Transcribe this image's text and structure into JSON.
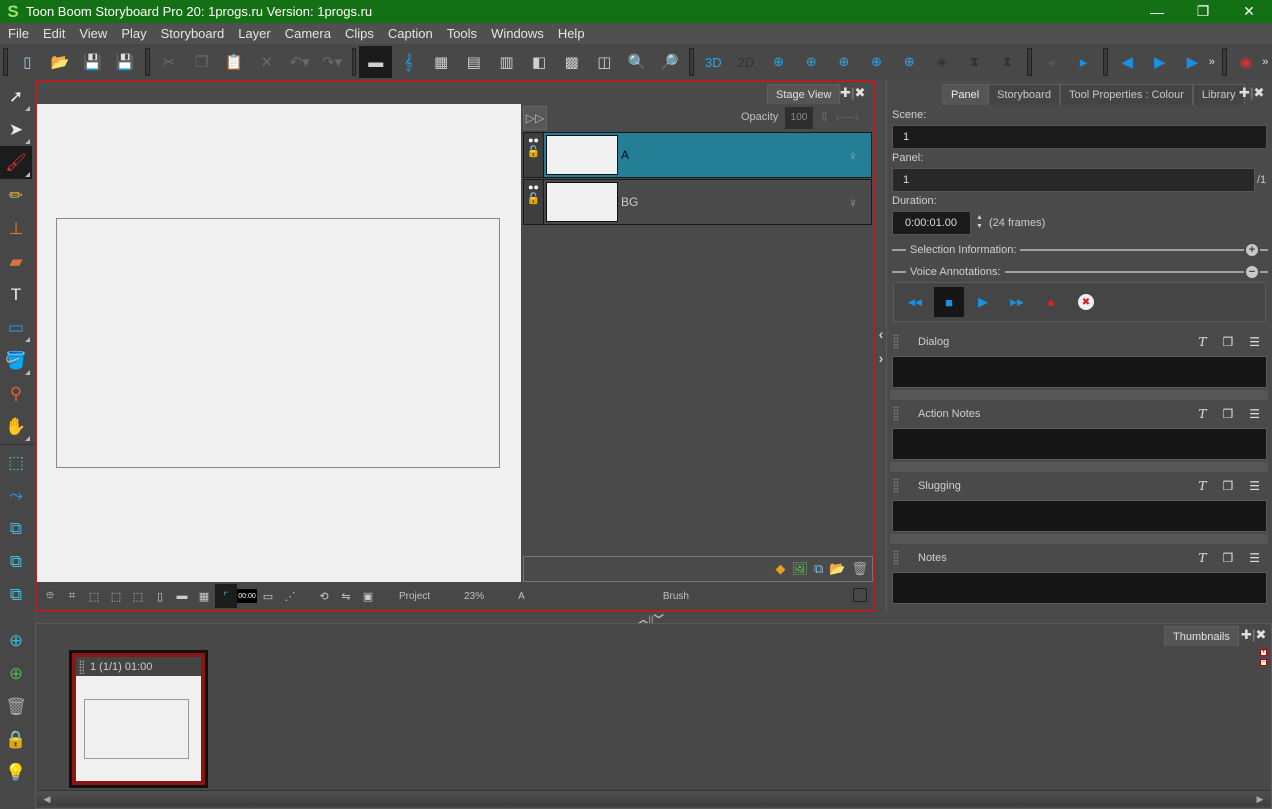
{
  "window": {
    "title": "Toon Boom Storyboard Pro 20: 1progs.ru Version: 1progs.ru",
    "logo": "S",
    "buttons": {
      "minimize": "—",
      "maximize": "❐",
      "close": "✕"
    }
  },
  "menu": [
    "File",
    "Edit",
    "View",
    "Play",
    "Storyboard",
    "Layer",
    "Camera",
    "Clips",
    "Caption",
    "Tools",
    "Windows",
    "Help"
  ],
  "toolbar": {
    "file_group": [
      {
        "name": "new-project-icon",
        "glyph": "▯"
      },
      {
        "name": "open-project-icon",
        "glyph": "📂"
      },
      {
        "name": "save-icon",
        "glyph": "💾"
      },
      {
        "name": "save-as-icon",
        "glyph": "💾"
      }
    ],
    "edit_group": [
      {
        "name": "cut-icon",
        "glyph": "✂"
      },
      {
        "name": "copy-icon",
        "glyph": "❐"
      },
      {
        "name": "paste-icon",
        "glyph": "📋"
      },
      {
        "name": "delete-icon",
        "glyph": "✕"
      },
      {
        "name": "undo-icon",
        "glyph": "↶▾"
      },
      {
        "name": "redo-icon",
        "glyph": "↷▾"
      }
    ],
    "view_group": [
      {
        "name": "horizontal-workspace-icon",
        "glyph": "▬"
      },
      {
        "name": "audio-clef-icon",
        "glyph": "𝄞"
      },
      {
        "name": "grid-layout-icon",
        "glyph": "▦"
      },
      {
        "name": "two-column-layout-icon",
        "glyph": "▤"
      },
      {
        "name": "list-layout-icon",
        "glyph": "▥"
      },
      {
        "name": "single-panel-layout-icon",
        "glyph": "◧"
      },
      {
        "name": "thumbnail-layout-icon",
        "glyph": "▩"
      },
      {
        "name": "timeline-layout-icon",
        "glyph": "◫"
      },
      {
        "name": "zoom-out-icon",
        "glyph": "🔍"
      },
      {
        "name": "zoom-in-icon",
        "glyph": "🔎"
      }
    ],
    "layer_group": [
      {
        "name": "convert-3d-icon",
        "glyph": "3D"
      },
      {
        "name": "convert-2d-icon",
        "glyph": "2D"
      },
      {
        "name": "add-panel-before-icon",
        "glyph": "⊕"
      },
      {
        "name": "add-panel-icon",
        "glyph": "⊕"
      },
      {
        "name": "add-panel-after-icon",
        "glyph": "⊕"
      },
      {
        "name": "split-panel-icon",
        "glyph": "⊕"
      },
      {
        "name": "smart-add-panel-icon",
        "glyph": "⊕"
      },
      {
        "name": "join-panel-icon",
        "glyph": "◈"
      },
      {
        "name": "add-transition-icon",
        "glyph": "⧗"
      },
      {
        "name": "remove-transition-icon",
        "glyph": "⧗"
      }
    ],
    "playback_group": [
      {
        "name": "previous-panel-icon",
        "glyph": "◂"
      },
      {
        "name": "next-panel-icon",
        "glyph": "▸"
      }
    ],
    "play_group": [
      {
        "name": "first-frame-icon",
        "glyph": "◀"
      },
      {
        "name": "play-selection-icon",
        "glyph": "▶"
      },
      {
        "name": "play-icon",
        "glyph": "▶"
      }
    ],
    "more": "»",
    "extra": {
      "name": "sound-scrub-icon",
      "glyph": "◉"
    }
  },
  "tools": [
    {
      "name": "select-tool-icon",
      "glyph": "➚",
      "has_menu": true,
      "color": "#e8e8e8"
    },
    {
      "name": "transform-tool-icon",
      "glyph": "➤",
      "has_menu": true,
      "color": "#e8e8e8"
    },
    {
      "name": "brush-tool-icon",
      "glyph": "🖌",
      "has_menu": true,
      "active": true,
      "color": "#d33"
    },
    {
      "name": "pencil-tool-icon",
      "glyph": "✏",
      "has_menu": false,
      "color": "#f0b040"
    },
    {
      "name": "stamp-tool-icon",
      "glyph": "⊥",
      "has_menu": false,
      "color": "#e08020"
    },
    {
      "name": "eraser-tool-icon",
      "glyph": "▰",
      "has_menu": false,
      "color": "#e07040"
    },
    {
      "name": "text-tool-icon",
      "glyph": "T",
      "has_menu": false,
      "color": "#eeeeee"
    },
    {
      "name": "rectangle-tool-icon",
      "glyph": "▭",
      "has_menu": true,
      "color": "#3399ee"
    },
    {
      "name": "paint-bucket-tool-icon",
      "glyph": "🪣",
      "has_menu": true,
      "color": "#d22"
    },
    {
      "name": "dropper-tool-icon",
      "glyph": "⚲",
      "has_menu": false,
      "color": "#e06030"
    },
    {
      "name": "hand-tool-icon",
      "glyph": "✋",
      "has_menu": true,
      "color": "#eeeeee"
    },
    {
      "name": "camera-box-icon",
      "glyph": "⬚",
      "has_menu": false,
      "color": "#40c0e0"
    },
    {
      "name": "layer-motion-icon",
      "glyph": "⤳",
      "has_menu": false,
      "color": "#3399ee"
    },
    {
      "name": "static-camera-icon",
      "glyph": "⧉",
      "has_menu": false,
      "color": "#40b0e0"
    },
    {
      "name": "move-layer-icon",
      "glyph": "⧉",
      "has_menu": false,
      "color": "#40c0e0"
    },
    {
      "name": "add-keyframe-layer-icon",
      "glyph": "⧉",
      "has_menu": false,
      "color": "#40c0e0"
    }
  ],
  "stage_view": {
    "tab_label": "Stage View",
    "tab_add": "✚",
    "tab_close": "✖",
    "opacity_label": "Opacity",
    "opacity_value": "100",
    "layers": [
      {
        "name": "A",
        "selected": true
      },
      {
        "name": "BG",
        "selected": false
      }
    ],
    "layer_footer_icons": [
      {
        "name": "add-vector-layer-icon",
        "glyph": "◆"
      },
      {
        "name": "add-bitmap-layer-icon",
        "glyph": "🖼"
      },
      {
        "name": "duplicate-layer-icon",
        "glyph": "⧉"
      },
      {
        "name": "add-group-icon",
        "glyph": "📂"
      },
      {
        "name": "delete-layer-icon",
        "glyph": "🗑"
      }
    ],
    "status_bar": {
      "buttons": [
        {
          "name": "reset-view-icon",
          "glyph": "⯐"
        },
        {
          "name": "field-guide-icon",
          "glyph": "⌗"
        },
        {
          "name": "safe-area-icon",
          "glyph": "⬚"
        },
        {
          "name": "title-safe-icon",
          "glyph": "⬚"
        },
        {
          "name": "action-safe-icon",
          "glyph": "⬚"
        },
        {
          "name": "frame-mask-icon",
          "glyph": "▯"
        },
        {
          "name": "mask-icon",
          "glyph": "▬"
        },
        {
          "name": "grid-icon",
          "glyph": "▦"
        },
        {
          "name": "camera-mask-icon",
          "glyph": "⌜",
          "active": true
        },
        {
          "name": "timecode-icon",
          "glyph": "00:00"
        },
        {
          "name": "caption-icon",
          "glyph": "▭"
        },
        {
          "name": "onion-skin-icon",
          "glyph": "⋰"
        },
        {
          "name": "rotate-view-icon",
          "glyph": "⟲"
        },
        {
          "name": "flip-view-icon",
          "glyph": "⇋"
        },
        {
          "name": "light-table-icon",
          "glyph": "▣"
        }
      ],
      "project_label": "Project",
      "zoom": "23%",
      "layer": "A",
      "tool": "Brush"
    }
  },
  "panel_view": {
    "tabs": [
      {
        "label": "Panel",
        "active": true
      },
      {
        "label": "Storyboard",
        "active": false
      },
      {
        "label": "Tool Properties : Colour",
        "active": false
      },
      {
        "label": "Library",
        "active": false
      }
    ],
    "tab_add": "✚",
    "tab_close": "✖",
    "scene_label": "Scene:",
    "scene_value": "1",
    "panel_label": "Panel:",
    "panel_value": "1",
    "panel_total": "/1",
    "duration_label": "Duration:",
    "duration_value": "0:00:01.00",
    "duration_frames": "(24 frames)",
    "selection_info_label": "Selection Information:",
    "voice_annotations_label": "Voice Annotations:",
    "voice_controls": [
      {
        "name": "rewind-icon",
        "glyph": "◀◀"
      },
      {
        "name": "stop-icon",
        "glyph": "■",
        "active": true
      },
      {
        "name": "play-icon",
        "glyph": "▶"
      },
      {
        "name": "fast-forward-icon",
        "glyph": "▶▶"
      },
      {
        "name": "record-icon",
        "glyph": "●"
      },
      {
        "name": "delete-recording-icon",
        "glyph": "✖"
      }
    ],
    "notes": [
      {
        "label": "Dialog",
        "value": ""
      },
      {
        "label": "Action Notes",
        "value": ""
      },
      {
        "label": "Slugging",
        "value": ""
      },
      {
        "label": "Notes",
        "value": ""
      }
    ]
  },
  "thumbnails": {
    "tab_label": "Thumbnails",
    "tab_add": "✚",
    "tab_close": "✖",
    "panels": [
      {
        "caption": "1 (1/1) 01:00",
        "selected": true
      }
    ],
    "side_tools": [
      {
        "name": "new-panel-icon",
        "glyph": "⊕"
      },
      {
        "name": "new-scene-icon",
        "glyph": "⊕"
      },
      {
        "name": "delete-panel-icon",
        "glyph": "🗑"
      },
      {
        "name": "lock-panel-icon",
        "glyph": "🔒"
      },
      {
        "name": "idea-icon",
        "glyph": "💡"
      }
    ]
  }
}
